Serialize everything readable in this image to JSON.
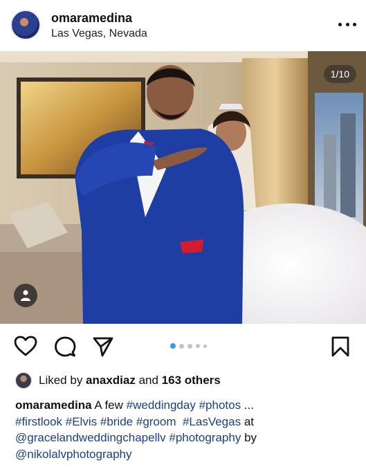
{
  "post": {
    "username": "omaramedina",
    "location": "Las Vegas, Nevada",
    "photo_counter": "1/10",
    "carousel": {
      "total_dots": 5,
      "active_index": 0
    }
  },
  "likes": {
    "prefix": "Liked by ",
    "user": "anaxdiaz",
    "middle": " and ",
    "count_text": "163 others"
  },
  "caption": {
    "username": "omaramedina",
    "text1": " A few ",
    "tag_weddingday": "#weddingday",
    "tag_photos": "#photos",
    "ellipsis": " ...",
    "tag_firstlook": "#firstlook",
    "tag_elvis": "#Elvis",
    "tag_bride": "#bride",
    "tag_groom": "#groom",
    "tag_lasvegas": "#LasVegas",
    "at": " at",
    "mention_chapel": "@gracelandweddingchapellv",
    "tag_photography": "#photography",
    "by": " by",
    "mention_photographer": "@nikolalvphotography"
  },
  "icons": {
    "like": "heart-icon",
    "comment": "comment-icon",
    "share": "send-icon",
    "save": "bookmark-icon",
    "more": "more-icon",
    "tag": "user-tag-icon"
  }
}
